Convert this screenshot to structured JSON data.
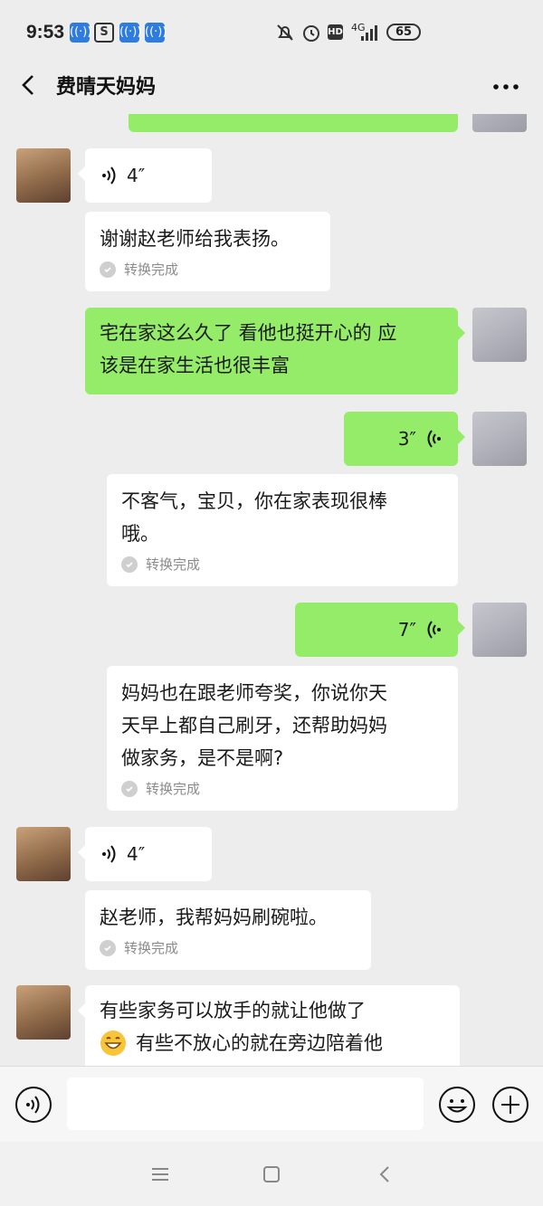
{
  "status_bar": {
    "time": "9:53",
    "network": "4G",
    "battery": "65"
  },
  "header": {
    "title": "费晴天妈妈"
  },
  "messages": [
    {
      "type": "voice",
      "duration": "4″"
    },
    {
      "type": "transcript",
      "text": "谢谢赵老师给我表扬。",
      "status": "转换完成"
    },
    {
      "type": "text",
      "text_line1": "宅在家这么久了 看他也挺开心的 应",
      "text_line2": "该是在家生活也很丰富"
    },
    {
      "type": "voice",
      "duration": "3″"
    },
    {
      "type": "transcript",
      "text_line1": "不客气，宝贝，你在家表现很棒",
      "text_line2": "哦。",
      "status": "转换完成"
    },
    {
      "type": "voice",
      "duration": "7″"
    },
    {
      "type": "transcript",
      "text_line1": "妈妈也在跟老师夸奖，你说你天",
      "text_line2": "天早上都自己刷牙，还帮助妈妈",
      "text_line3": "做家务，是不是啊?",
      "status": "转换完成"
    },
    {
      "type": "voice",
      "duration": "4″"
    },
    {
      "type": "transcript",
      "text": "赵老师，我帮妈妈刷碗啦。",
      "status": "转换完成"
    },
    {
      "type": "text",
      "text_line1": "有些家务可以放手的就让他做了",
      "text_line2": "有些不放心的就在旁边陪着他"
    }
  ],
  "colors": {
    "background": "#ededed",
    "outgoing_bubble": "#95ec69",
    "incoming_bubble": "#ffffff",
    "status_icon": "#2f7ce0"
  }
}
